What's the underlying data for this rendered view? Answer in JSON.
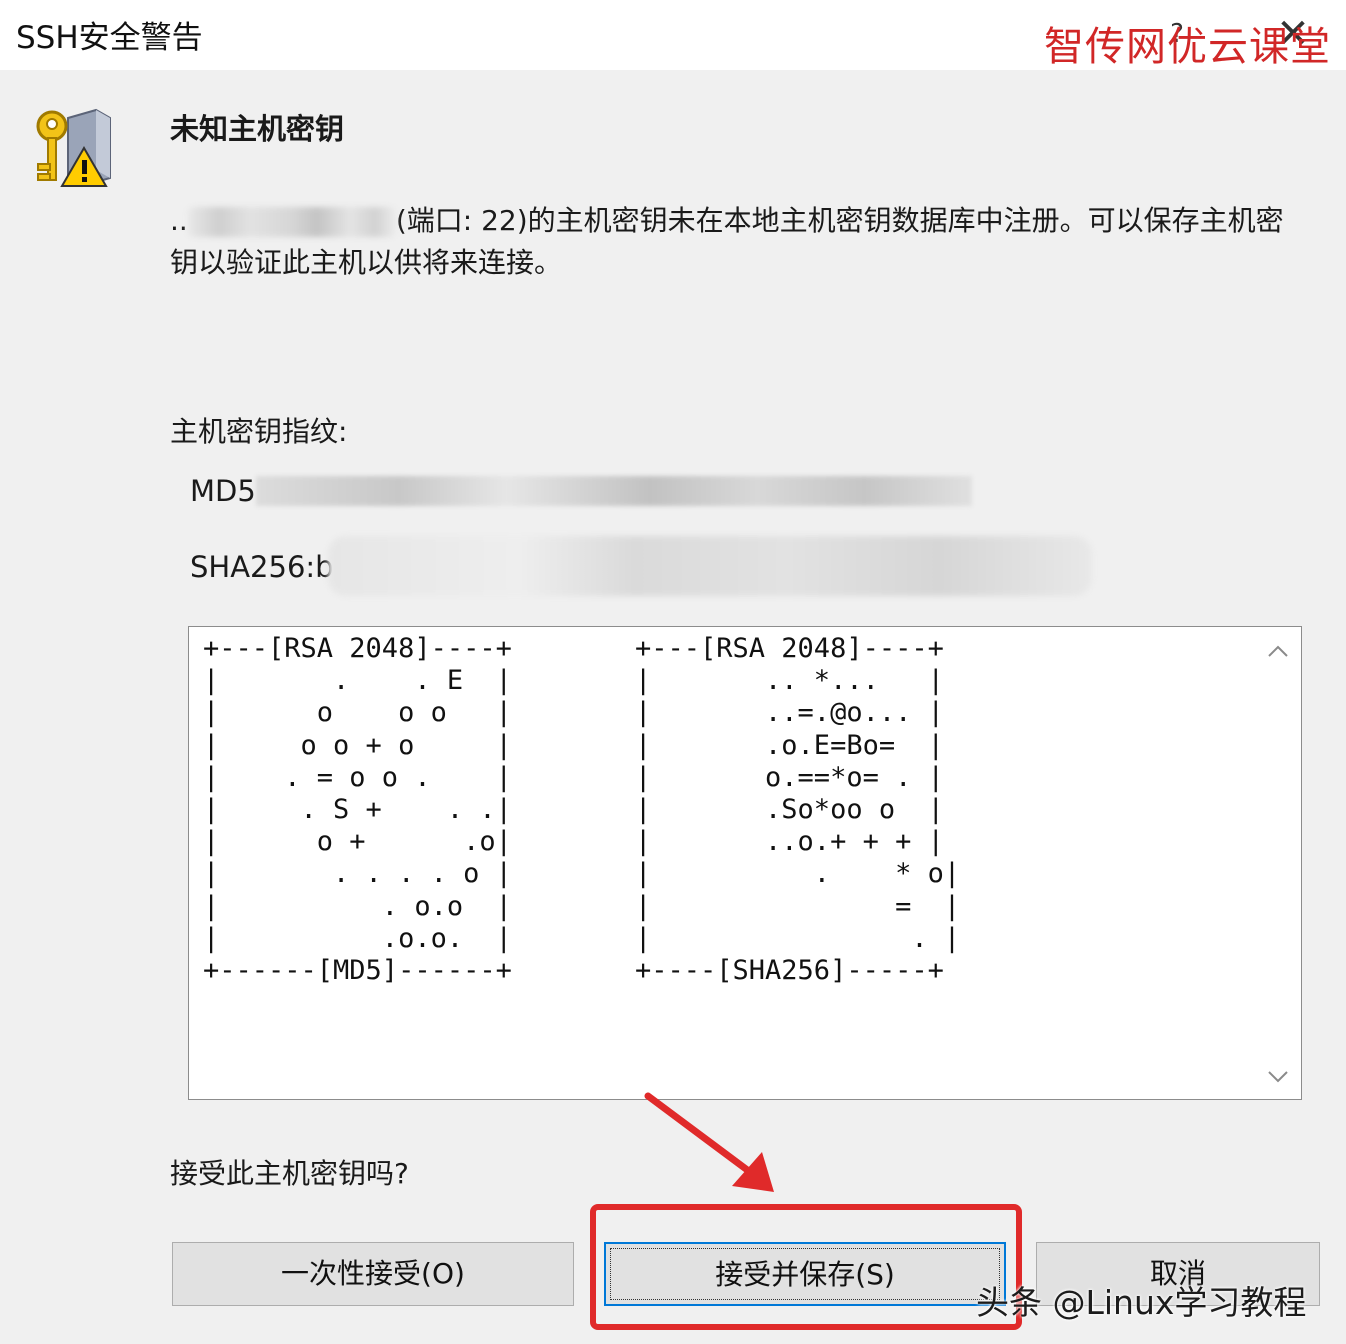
{
  "window": {
    "title": "SSH安全警告",
    "help_glyph": "?",
    "close_glyph": "✕"
  },
  "watermark_top": "智传网优云课堂",
  "dialog": {
    "heading": "未知主机密钥",
    "message_prefix": "..",
    "message_text": "(端口: 22)的主机密钥未在本地主机密钥数据库中注册。可以保存主机密钥以验证此主机以供将来连接。",
    "fingerprint_label": "主机密钥指纹:",
    "md5_prefix": "MD5",
    "sha256_prefix": "SHA256:b",
    "randomart_md5": "+---[RSA 2048]----+\n|       .    . E  |\n|      o    o o   |\n|     o o + o     |\n|    . = o o .    |\n|     . S +    . .|\n|      o +      .o|\n|       . . . . o |\n|          . o.o  |\n|          .o.o.  |\n+------[MD5]------+",
    "randomart_sha256": "+---[RSA 2048]----+\n|       .. *...   |\n|       ..=.@o... |\n|       .o.E=Bo=  |\n|       o.==*o= . |\n|       .So*oo o  |\n|       ..o.+ + + |\n|          .    * o|\n|               =  |\n|                . |\n+----[SHA256]-----+",
    "question": "接受此主机密钥吗?"
  },
  "buttons": {
    "accept_once": "一次性接受(O)",
    "accept_save": "接受并保存(S)",
    "cancel": "取消"
  },
  "watermark_bottom": "头条 @Linux学习教程",
  "colors": {
    "annotation_red": "#e02a2a",
    "focus_blue": "#0078d7",
    "watermark_red": "#d12727"
  }
}
